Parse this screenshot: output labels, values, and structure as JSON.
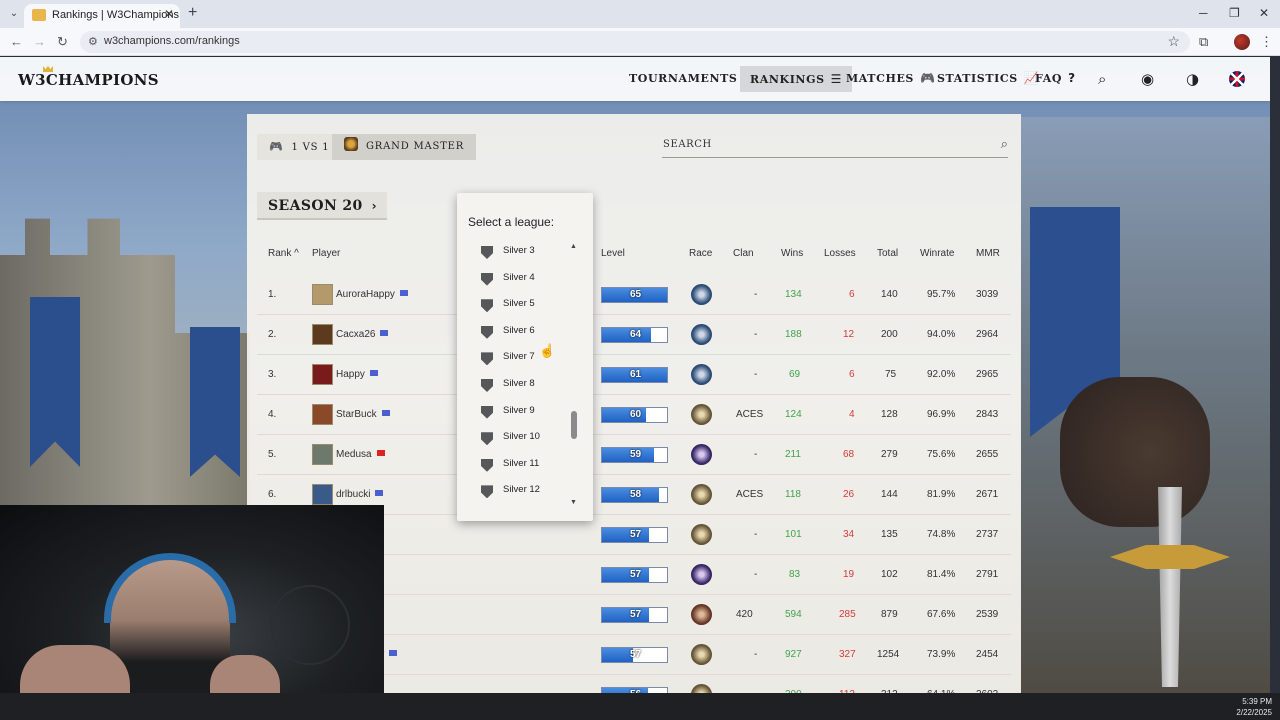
{
  "browser": {
    "tab_title": "Rankings | W3Champions",
    "url": "w3champions.com/rankings",
    "tab_close": "✕",
    "new_tab": "+"
  },
  "header": {
    "logo": "W3CHAMPIONS",
    "nav": [
      {
        "label": "TOURNAMENTS",
        "glyph": "🏆"
      },
      {
        "label": "RANKINGS",
        "glyph": "☰"
      },
      {
        "label": "MATCHES",
        "glyph": "🎮"
      },
      {
        "label": "STATISTICS",
        "glyph": "📈"
      },
      {
        "label": "FAQ",
        "glyph": "?"
      }
    ]
  },
  "filters": {
    "mode": "1 VS 1",
    "league": "GRAND MASTER",
    "season": "SEASON 20",
    "search_label": "SEARCH"
  },
  "table": {
    "headers": {
      "rank": "Rank",
      "player": "Player",
      "level": "Level",
      "race": "Race",
      "clan": "Clan",
      "wins": "Wins",
      "losses": "Losses",
      "total": "Total",
      "winrate": "Winrate",
      "mmr": "MMR"
    },
    "rows": [
      {
        "rank": "1.",
        "player": "AuroraHappy",
        "level": "65",
        "level_pct": 1.0,
        "clan": "-",
        "wins": "134",
        "losses": "6",
        "total": "140",
        "winrate": "95.7%",
        "mmr": "3039"
      },
      {
        "rank": "2.",
        "player": "Cacxa26",
        "level": "64",
        "level_pct": 0.75,
        "clan": "-",
        "wins": "188",
        "losses": "12",
        "total": "200",
        "winrate": "94.0%",
        "mmr": "2964"
      },
      {
        "rank": "3.",
        "player": "Happy",
        "level": "61",
        "level_pct": 1.0,
        "clan": "-",
        "wins": "69",
        "losses": "6",
        "total": "75",
        "winrate": "92.0%",
        "mmr": "2965"
      },
      {
        "rank": "4.",
        "player": "StarBuck",
        "level": "60",
        "level_pct": 0.68,
        "clan": "ACES",
        "wins": "124",
        "losses": "4",
        "total": "128",
        "winrate": "96.9%",
        "mmr": "2843"
      },
      {
        "rank": "5.",
        "player": "Medusa",
        "level": "59",
        "level_pct": 0.8,
        "clan": "-",
        "wins": "211",
        "losses": "68",
        "total": "279",
        "winrate": "75.6%",
        "mmr": "2655"
      },
      {
        "rank": "6.",
        "player": "drlbucki",
        "level": "58",
        "level_pct": 0.88,
        "clan": "ACES",
        "wins": "118",
        "losses": "26",
        "total": "144",
        "winrate": "81.9%",
        "mmr": "2671"
      },
      {
        "rank": "",
        "player": "",
        "level": "57",
        "level_pct": 0.73,
        "clan": "-",
        "wins": "101",
        "losses": "34",
        "total": "135",
        "winrate": "74.8%",
        "mmr": "2737"
      },
      {
        "rank": "",
        "player": "",
        "level": "57",
        "level_pct": 0.73,
        "clan": "-",
        "wins": "83",
        "losses": "19",
        "total": "102",
        "winrate": "81.4%",
        "mmr": "2791"
      },
      {
        "rank": "",
        "player": "",
        "level": "57",
        "level_pct": 0.73,
        "clan": "420",
        "wins": "594",
        "losses": "285",
        "total": "879",
        "winrate": "67.6%",
        "mmr": "2539"
      },
      {
        "rank": "",
        "player": "r",
        "level": "57",
        "level_pct": 0.48,
        "clan": "-",
        "wins": "927",
        "losses": "327",
        "total": "1254",
        "winrate": "73.9%",
        "mmr": "2454"
      },
      {
        "rank": "",
        "player": "",
        "level": "56",
        "level_pct": 0.7,
        "clan": "-",
        "wins": "200",
        "losses": "112",
        "total": "312",
        "winrate": "64.1%",
        "mmr": "2602"
      }
    ]
  },
  "league_dropdown": {
    "title": "Select a league:",
    "items": [
      "Silver 3",
      "Silver 4",
      "Silver 5",
      "Silver 6",
      "Silver 7",
      "Silver 8",
      "Silver 9",
      "Silver 10",
      "Silver 11",
      "Silver 12"
    ]
  },
  "taskbar": {
    "time": "5:39 PM",
    "date": "2/22/2025"
  },
  "colors": {
    "wins": "#3fa34d",
    "losses": "#d23a3a",
    "level_bar": "#1f62c4"
  }
}
